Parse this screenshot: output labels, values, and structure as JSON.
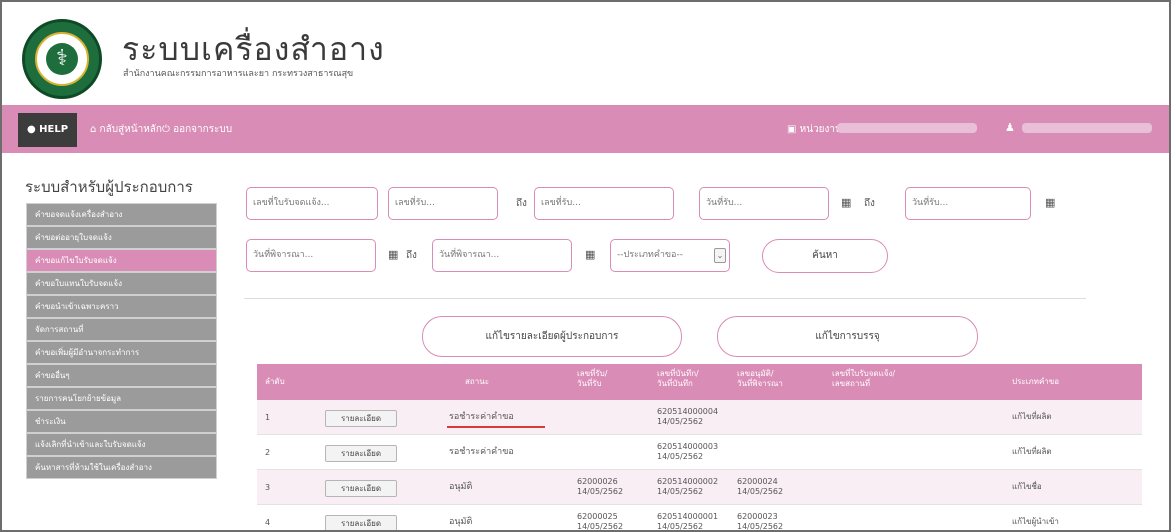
{
  "header": {
    "title": "ระบบเครื่องสำอาง",
    "subtitle": "สำนักงานคณะกรรมการอาหารและยา กระทรวงสาธารณสุข"
  },
  "navbar": {
    "help": "HELP",
    "home": "กลับสู่หน้าหลัก",
    "logout": "ออกจากระบบ",
    "department_label": "หน่วยงาน :"
  },
  "sidebar": {
    "title": "ระบบสำหรับผู้ประกอบการ",
    "items": [
      {
        "label": "คำขอจดแจ้งเครื่องสำอาง",
        "active": false
      },
      {
        "label": "คำขอต่ออายุใบจดแจ้ง",
        "active": false
      },
      {
        "label": "คำขอแก้ไขใบรับจดแจ้ง",
        "active": true
      },
      {
        "label": "คำขอใบแทนใบรับจดแจ้ง",
        "active": false
      },
      {
        "label": "คำขอนำเข้าเฉพาะคราว",
        "active": false
      },
      {
        "label": "จัดการสถานที่",
        "active": false
      },
      {
        "label": "คำขอเพิ่มผู้มีอำนาจกระทำการ",
        "active": false
      },
      {
        "label": "คำขออื่นๆ",
        "active": false
      },
      {
        "label": "รายการคนโยกย้ายข้อมูล",
        "active": false
      },
      {
        "label": "ชำระเงิน",
        "active": false
      },
      {
        "label": "แจ้งเลิกที่นำเข้าและใบรับจดแจ้ง",
        "active": false
      },
      {
        "label": "ค้นหาสารที่ห้ามใช้ในเครื่องสำอาง",
        "active": false
      }
    ]
  },
  "filters": {
    "license_no_placeholder": "เลขที่ใบรับจดแจ้ง...",
    "receipt_from_placeholder": "เลขที่รับ...",
    "to_label": "ถึง",
    "receipt_to_placeholder": "เลขที่รับ...",
    "receive_date_from_placeholder": "วันที่รับ...",
    "receive_date_to_placeholder": "วันที่รับ...",
    "review_date_from_placeholder": "วันที่พิจารณา...",
    "review_date_to_placeholder": "วันที่พิจารณา...",
    "request_type_selected": "--ประเภทคำขอ--",
    "search_button": "ค้นหา"
  },
  "actions": {
    "edit_operator": "แก้ไขรายละเอียดผู้ประกอบการ",
    "edit_packaging": "แก้ไขการบรรจุ"
  },
  "table": {
    "headers": {
      "order": "ลำดับ",
      "status": "สถานะ",
      "receipt_no": "เลขที่รับ/",
      "receipt_date": "วันที่รับ",
      "record_no": "เลขที่บันทึก/",
      "record_date": "วันที่บันทึก",
      "approval_no": "เลขอนุมัติ/",
      "review_date": "วันที่พิจารณา",
      "license_no": "เลขที่ใบรับจดแจ้ง/",
      "location_no": "เลขสถานที่",
      "request_type": "ประเภทคำขอ"
    },
    "detail_button": "รายละเอียด",
    "rows": [
      {
        "order": "1",
        "status": "รอชำระค่าคำขอ",
        "receipt_no": "",
        "receipt_date": "",
        "record_no": "620514000004",
        "record_date": "14/05/2562",
        "approval_no": "",
        "review_date": "",
        "request_type": "แก้ไขที่ผลิต"
      },
      {
        "order": "2",
        "status": "รอชำระค่าคำขอ",
        "receipt_no": "",
        "receipt_date": "",
        "record_no": "620514000003",
        "record_date": "14/05/2562",
        "approval_no": "",
        "review_date": "",
        "request_type": "แก้ไขที่ผลิต"
      },
      {
        "order": "3",
        "status": "อนุมัติ",
        "receipt_no": "62000026",
        "receipt_date": "14/05/2562",
        "record_no": "620514000002",
        "record_date": "14/05/2562",
        "approval_no": "62000024",
        "review_date": "14/05/2562",
        "request_type": "แก้ไขชื่อ"
      },
      {
        "order": "4",
        "status": "อนุมัติ",
        "receipt_no": "62000025",
        "receipt_date": "14/05/2562",
        "record_no": "620514000001",
        "record_date": "14/05/2562",
        "approval_no": "62000023",
        "review_date": "14/05/2562",
        "request_type": "แก้ไขผู้นำเข้า"
      }
    ]
  },
  "colors": {
    "accent_pink": "#d98cb6",
    "sidebar_gray": "#9b9b9b",
    "nav_dark": "#3c3c3c",
    "status_underline": "#d63b3b"
  }
}
